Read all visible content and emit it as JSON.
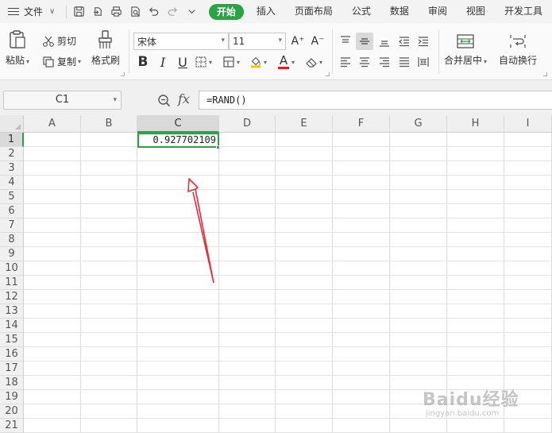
{
  "menubar": {
    "file_label": "文件",
    "tabs": [
      {
        "label": "开始",
        "active": true
      },
      {
        "label": "插入",
        "active": false
      },
      {
        "label": "页面布局",
        "active": false
      },
      {
        "label": "公式",
        "active": false
      },
      {
        "label": "数据",
        "active": false
      },
      {
        "label": "审阅",
        "active": false
      },
      {
        "label": "视图",
        "active": false
      },
      {
        "label": "开发工具",
        "active": false
      }
    ],
    "accent_color": "#2ba245"
  },
  "ribbon": {
    "paste_label": "粘贴",
    "cut_label": "剪切",
    "copy_label": "复制",
    "format_painter_label": "格式刷",
    "font_name": "宋体",
    "font_size": "11",
    "grow_font": "A⁺",
    "shrink_font": "A⁻",
    "bold": "B",
    "italic": "I",
    "underline": "U",
    "font_color_letter": "A",
    "merge_center_label": "合并居中",
    "wrap_text_label": "自动换行",
    "font_color_swatch": "#e02020",
    "fill_color_swatch": "#f5c400"
  },
  "formula_bar": {
    "name_box": "C1",
    "fx_label": "fx",
    "formula": "=RAND()"
  },
  "sheet": {
    "columns": [
      "A",
      "B",
      "C",
      "D",
      "E",
      "F",
      "G",
      "H",
      "I"
    ],
    "rows": [
      "1",
      "2",
      "3",
      "4",
      "5",
      "6",
      "7",
      "8",
      "9",
      "10",
      "11",
      "12",
      "13",
      "14",
      "15",
      "16",
      "17",
      "18",
      "19",
      "20",
      "21"
    ],
    "selected_column": "C",
    "selected_row": "1",
    "active_cell_value": "0.927702109"
  },
  "annotation": {
    "arrow_color": "#e0303a"
  },
  "watermark": {
    "brand": "Baidu经验",
    "url": "jingyan.baidu.com"
  }
}
